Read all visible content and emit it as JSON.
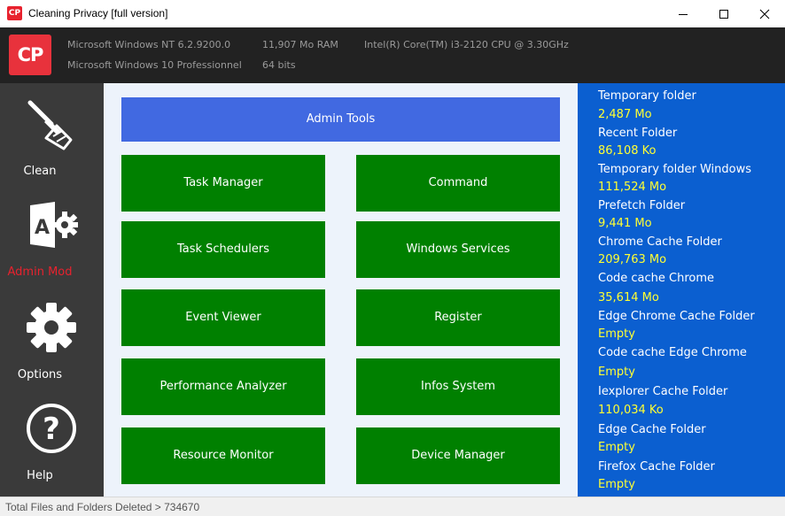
{
  "window": {
    "icon_text": "CP",
    "title": "Cleaning Privacy [full version]"
  },
  "header": {
    "logo_text": "CP",
    "os_version": "Microsoft Windows NT 6.2.9200.0",
    "ram": "11,907 Mo RAM",
    "cpu": "Intel(R) Core(TM) i3-2120 CPU @ 3.30GHz",
    "os_name": "Microsoft Windows 10 Professionnel",
    "arch": "64 bits"
  },
  "sidebar": {
    "items": [
      {
        "label": "Clean",
        "icon": "broom-icon"
      },
      {
        "label": "Admin Mod",
        "icon": "access-gear-icon",
        "active": true
      },
      {
        "label": "Options",
        "icon": "gear-icon"
      },
      {
        "label": "Help",
        "icon": "question-icon"
      }
    ]
  },
  "center": {
    "header_button": "Admin Tools",
    "buttons": [
      "Task Manager",
      "Command",
      "Task Schedulers",
      "Windows Services",
      "Event Viewer",
      "Register",
      "Performance Analyzer",
      "Infos System",
      "Resource Monitor",
      "Device Manager"
    ]
  },
  "folders": [
    {
      "name": "Temporary folder",
      "size": "2,487 Mo"
    },
    {
      "name": "Recent Folder",
      "size": "86,108 Ko"
    },
    {
      "name": "Temporary folder Windows",
      "size": "111,524 Mo"
    },
    {
      "name": "Prefetch Folder",
      "size": "9,441 Mo"
    },
    {
      "name": "Chrome Cache Folder",
      "size": "209,763 Mo"
    },
    {
      "name": "Code cache Chrome",
      "size": "35,614 Mo"
    },
    {
      "name": "Edge Chrome Cache Folder",
      "size": "Empty"
    },
    {
      "name": "Code cache Edge Chrome",
      "size": "Empty"
    },
    {
      "name": "Iexplorer Cache Folder",
      "size": "110,034 Ko"
    },
    {
      "name": "Edge Cache Folder",
      "size": "Empty"
    },
    {
      "name": "Firefox Cache Folder",
      "size": "Empty"
    }
  ],
  "status": {
    "text": "Total Files and Folders Deleted > 734670"
  },
  "colors": {
    "accent_blue": "#4169e1",
    "button_green": "#008000",
    "panel_blue": "#0b5fd0",
    "value_yellow": "#ffff33",
    "active_red": "#e8222e"
  }
}
